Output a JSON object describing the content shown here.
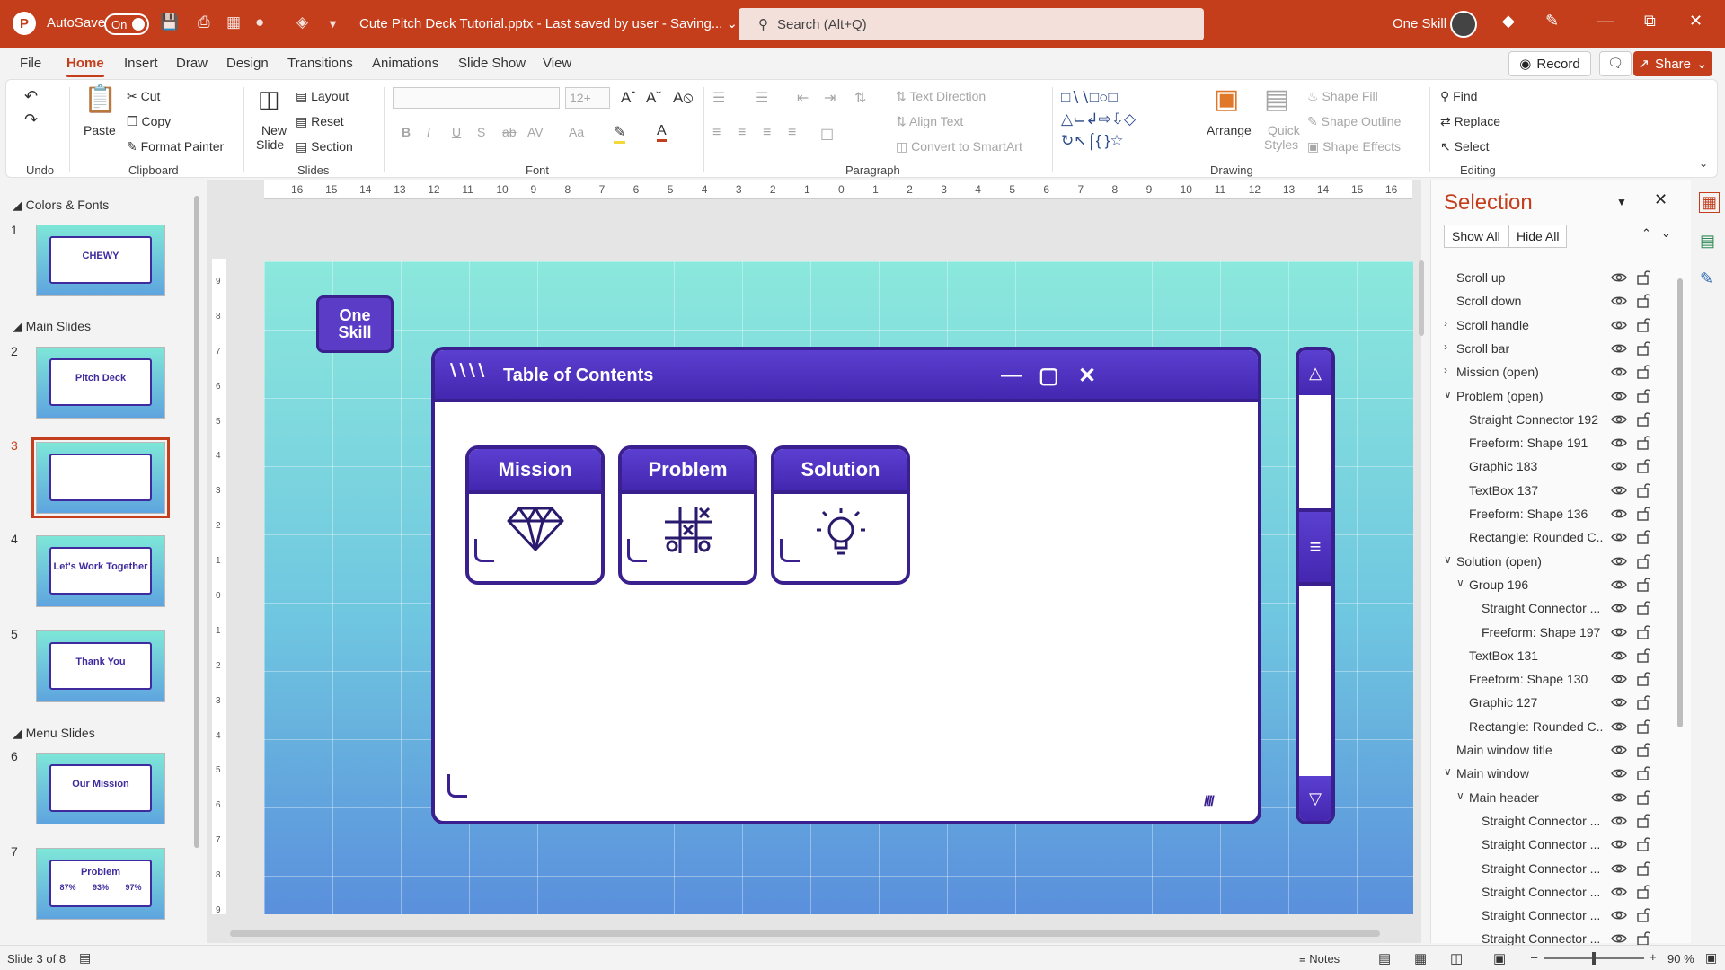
{
  "app": {
    "autosave_label": "AutoSave",
    "autosave_state": "On",
    "file_title": "Cute Pitch Deck Tutorial.pptx  -  Last saved by user  -  Saving...",
    "search_placeholder": "Search (Alt+Q)",
    "user_name": "One Skill"
  },
  "tabs": [
    "File",
    "Home",
    "Insert",
    "Draw",
    "Design",
    "Transitions",
    "Animations",
    "Slide Show",
    "View"
  ],
  "active_tab": "Home",
  "actions": {
    "record": "Record",
    "share": "Share"
  },
  "ribbon": {
    "undo_group": "Undo",
    "clipboard": {
      "paste": "Paste",
      "cut": "Cut",
      "copy": "Copy",
      "format_painter": "Format Painter",
      "label": "Clipboard"
    },
    "slides": {
      "new_slide_1": "New",
      "new_slide_2": "Slide",
      "layout": "Layout",
      "reset": "Reset",
      "section": "Section",
      "label": "Slides"
    },
    "font": {
      "size": "12+",
      "label": "Font"
    },
    "paragraph": {
      "text_direction": "Text Direction",
      "align_text": "Align Text",
      "convert_smartart": "Convert to SmartArt",
      "label": "Paragraph"
    },
    "drawing": {
      "arrange": "Arrange",
      "quick_styles_1": "Quick",
      "quick_styles_2": "Styles",
      "shape_fill": "Shape Fill",
      "shape_outline": "Shape Outline",
      "shape_effects": "Shape Effects",
      "label": "Drawing"
    },
    "editing": {
      "find": "Find",
      "replace": "Replace",
      "select": "Select",
      "label": "Editing"
    }
  },
  "thumbnails": {
    "sections": [
      "Colors & Fonts",
      "Main Slides",
      "Menu Slides"
    ],
    "slides": [
      {
        "num": "1",
        "text": "CHEWY"
      },
      {
        "num": "2",
        "text": "Pitch Deck"
      },
      {
        "num": "3",
        "text": ""
      },
      {
        "num": "4",
        "text": "Let's Work Together"
      },
      {
        "num": "5",
        "text": "Thank You"
      },
      {
        "num": "6",
        "text": "Our Mission"
      },
      {
        "num": "7",
        "text": "Problem"
      }
    ],
    "slide7_stats": [
      "87%",
      "93%",
      "97%"
    ]
  },
  "ruler": {
    "h_ticks": [
      "16",
      "15",
      "14",
      "13",
      "12",
      "11",
      "10",
      "9",
      "8",
      "7",
      "6",
      "5",
      "4",
      "3",
      "2",
      "1",
      "0",
      "1",
      "2",
      "3",
      "4",
      "5",
      "6",
      "7",
      "8",
      "9",
      "10",
      "11",
      "12",
      "13",
      "14",
      "15",
      "16"
    ],
    "v_ticks": [
      "9",
      "8",
      "7",
      "6",
      "5",
      "4",
      "3",
      "2",
      "1",
      "0",
      "1",
      "2",
      "3",
      "4",
      "5",
      "6",
      "7",
      "8",
      "9"
    ]
  },
  "slide": {
    "logo_line1": "One",
    "logo_line2": "Skill",
    "window_title": "Table of Contents",
    "cards": [
      {
        "title": "Mission",
        "icon": "diamond-icon"
      },
      {
        "title": "Problem",
        "icon": "tic-tac-toe-icon"
      },
      {
        "title": "Solution",
        "icon": "lightbulb-icon"
      }
    ]
  },
  "selection": {
    "title": "Selection",
    "show_all": "Show All",
    "hide_all": "Hide All",
    "items": [
      {
        "label": "Scroll up",
        "level": 0,
        "expand": ""
      },
      {
        "label": "Scroll down",
        "level": 0,
        "expand": ""
      },
      {
        "label": "Scroll handle",
        "level": 0,
        "expand": "collapsed"
      },
      {
        "label": "Scroll bar",
        "level": 0,
        "expand": "collapsed"
      },
      {
        "label": "Mission (open)",
        "level": 0,
        "expand": "collapsed"
      },
      {
        "label": "Problem (open)",
        "level": 0,
        "expand": "expanded"
      },
      {
        "label": "Straight Connector 192",
        "level": 1,
        "expand": ""
      },
      {
        "label": "Freeform: Shape 191",
        "level": 1,
        "expand": ""
      },
      {
        "label": "Graphic 183",
        "level": 1,
        "expand": ""
      },
      {
        "label": "TextBox 137",
        "level": 1,
        "expand": ""
      },
      {
        "label": "Freeform: Shape 136",
        "level": 1,
        "expand": ""
      },
      {
        "label": "Rectangle: Rounded C...",
        "level": 1,
        "expand": ""
      },
      {
        "label": "Solution (open)",
        "level": 0,
        "expand": "expanded"
      },
      {
        "label": "Group 196",
        "level": 1,
        "expand": "expanded"
      },
      {
        "label": "Straight Connector ...",
        "level": 2,
        "expand": ""
      },
      {
        "label": "Freeform: Shape 197",
        "level": 2,
        "expand": ""
      },
      {
        "label": "TextBox 131",
        "level": 1,
        "expand": ""
      },
      {
        "label": "Freeform: Shape 130",
        "level": 1,
        "expand": ""
      },
      {
        "label": "Graphic 127",
        "level": 1,
        "expand": ""
      },
      {
        "label": "Rectangle: Rounded C...",
        "level": 1,
        "expand": ""
      },
      {
        "label": "Main window title",
        "level": 0,
        "expand": ""
      },
      {
        "label": "Main window",
        "level": 0,
        "expand": "expanded"
      },
      {
        "label": "Main header",
        "level": 1,
        "expand": "expanded"
      },
      {
        "label": "Straight Connector ...",
        "level": 2,
        "expand": ""
      },
      {
        "label": "Straight Connector ...",
        "level": 2,
        "expand": ""
      },
      {
        "label": "Straight Connector ...",
        "level": 2,
        "expand": ""
      },
      {
        "label": "Straight Connector ...",
        "level": 2,
        "expand": ""
      },
      {
        "label": "Straight Connector ...",
        "level": 2,
        "expand": ""
      },
      {
        "label": "Straight Connector ...",
        "level": 2,
        "expand": ""
      }
    ]
  },
  "status": {
    "slide_of": "Slide 3 of 8",
    "notes": "Notes",
    "zoom": "90 %"
  },
  "colors": {
    "accent": "#c43e1c",
    "slide_purple": "#4427b0",
    "slide_border": "#3a1f8f"
  }
}
